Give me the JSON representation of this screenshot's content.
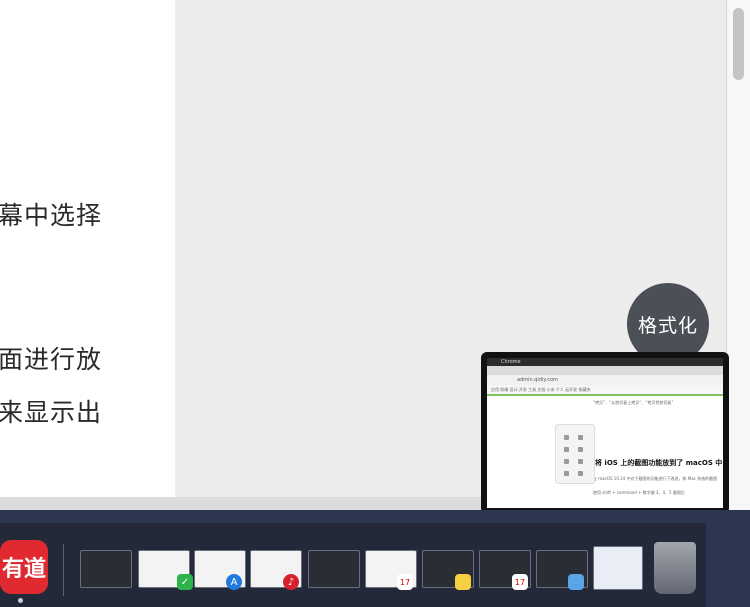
{
  "document": {
    "lines": [
      "幕中选择",
      "面进行放",
      "来显示出"
    ]
  },
  "floating_button": {
    "label": "格式化"
  },
  "screenshot_preview": {
    "menubar": "Chrome",
    "url": "admin.qidiy.com",
    "bookmarks": "应用  前端  设计  开发  工具  文档  小米  个人  云开发  收藏夹",
    "heading": "将 iOS 上的截图功能放到了 macOS 中",
    "body_lines": [
      "“拷贝”、“从剪切板上拷贝”、“拷贝到剪切板”",
      "在 macOS 10.14 中对于截图的功能进行了改进，和 Mac 系统的截图",
      "使用 shift + command + 数字键 3、4、5 截图后"
    ]
  },
  "dock": {
    "youdao_label": "有道",
    "calendar_day": "17",
    "items": [
      "youdao-dictionary",
      "finder-window",
      "evernote-window",
      "appstore-window",
      "netease-music-window",
      "terminal-window",
      "calendar-window",
      "notes-window",
      "calendar-window-2",
      "finder-window-2",
      "preview-window",
      "trash"
    ]
  },
  "colors": {
    "format_button": "#4b4f56",
    "dock": "#2c3650",
    "youdao": "#e12a2f"
  }
}
